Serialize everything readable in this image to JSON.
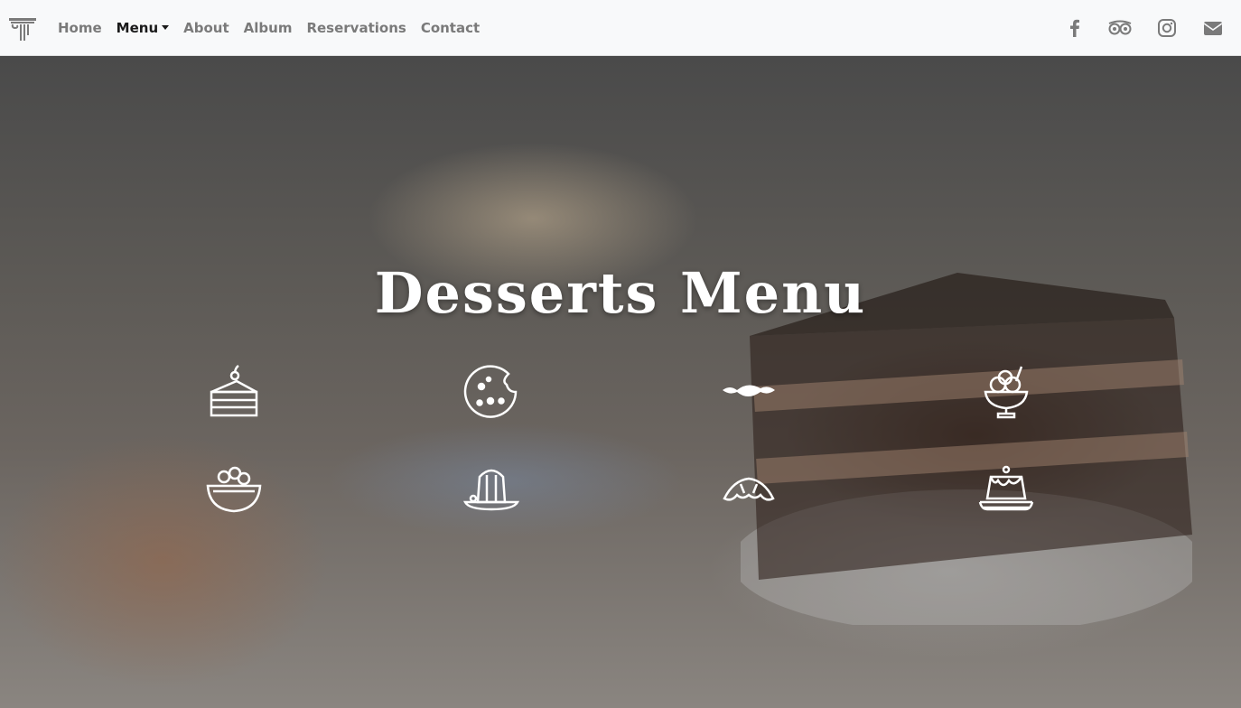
{
  "nav": {
    "brand_icon": "column-logo-icon",
    "links": [
      {
        "label": "Home"
      },
      {
        "label": "Menu"
      },
      {
        "label": "About"
      },
      {
        "label": "Album"
      },
      {
        "label": "Reservations"
      },
      {
        "label": "Contact"
      }
    ],
    "social_icons": [
      "facebook-icon",
      "tripadvisor-icon",
      "instagram-icon",
      "envelope-icon"
    ]
  },
  "hero": {
    "title": "Desserts Menu",
    "icons": [
      "cake-slice-icon",
      "cookie-icon",
      "candy-icon",
      "ice-cream-sundae-icon",
      "fruit-bowl-icon",
      "jelly-pudding-icon",
      "croissant-icon",
      "flan-icon"
    ]
  },
  "colors": {
    "navbar_bg": "#f8f9fa",
    "nav_text": "#7a7a7a",
    "nav_active": "#1a1a1a",
    "hero_text": "#ffffff"
  }
}
